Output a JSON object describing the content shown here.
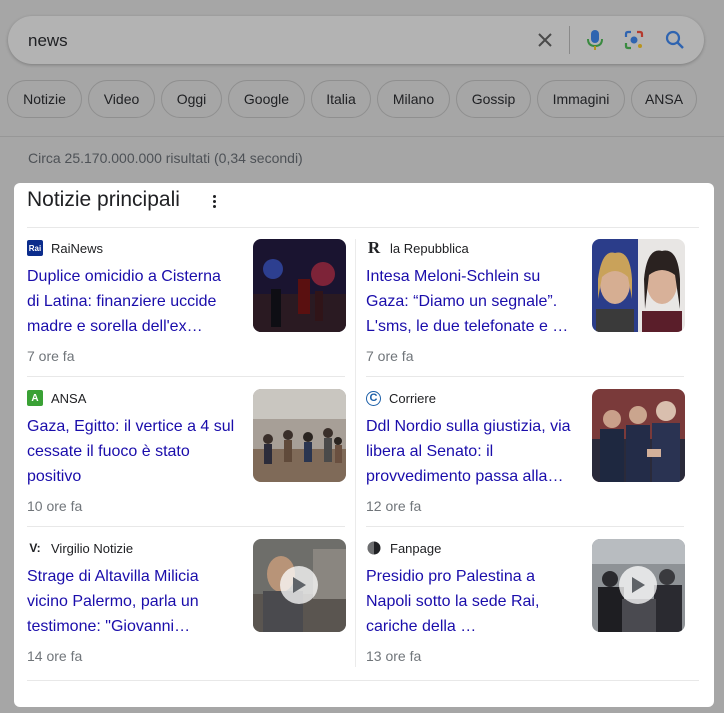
{
  "search": {
    "query": "news"
  },
  "chips": [
    "Notizie",
    "Video",
    "Oggi",
    "Google",
    "Italia",
    "Milano",
    "Gossip",
    "Immagini",
    "ANSA"
  ],
  "result_stats": "Circa 25.170.000.000 risultati (0,34 secondi)",
  "top_stories": {
    "title": "Notizie principali",
    "articles": [
      {
        "source": "RaiNews",
        "logo_text": "Rai",
        "logo_color": "#0b2c8c",
        "headline": "Duplice omicidio a Cisterna di Latina: finanziere uccide madre e sorella dell'ex…",
        "age": "7 ore fa",
        "thumb": "night-crime-scene"
      },
      {
        "source": "la Repubblica",
        "logo_text": "R",
        "logo_color": "#202124",
        "headline": "Intesa Meloni-Schlein su Gaza: “Diamo un segnale”. L'sms, le due telefonate e …",
        "age": "7 ore fa",
        "thumb": "two-politicians"
      },
      {
        "source": "ANSA",
        "logo_text": "A",
        "logo_color": "#3aa135",
        "headline": "Gaza, Egitto: il vertice a 4 sul cessate il fuoco è stato positivo",
        "age": "10 ore fa",
        "thumb": "crowd-street"
      },
      {
        "source": "Corriere",
        "logo_text": "C",
        "logo_color": "#1c5fa8",
        "headline": "Ddl Nordio sulla giustizia, via libera al Senato: il provvedimento passa alla…",
        "age": "12 ore fa",
        "thumb": "senate-handshake"
      },
      {
        "source": "Virgilio Notizie",
        "logo_text": "V:",
        "logo_color": "#202124",
        "headline": "Strage di Altavilla Milicia vicino Palermo, parla un testimone: \"Giovanni…",
        "age": "14 ore fa",
        "thumb": "video-witness"
      },
      {
        "source": "Fanpage",
        "logo_text": "",
        "logo_color": "#202124",
        "headline": "Presidio pro Palestina a Napoli sotto la sede Rai, cariche della …",
        "age": "13 ore fa",
        "thumb": "video-protest"
      }
    ]
  }
}
